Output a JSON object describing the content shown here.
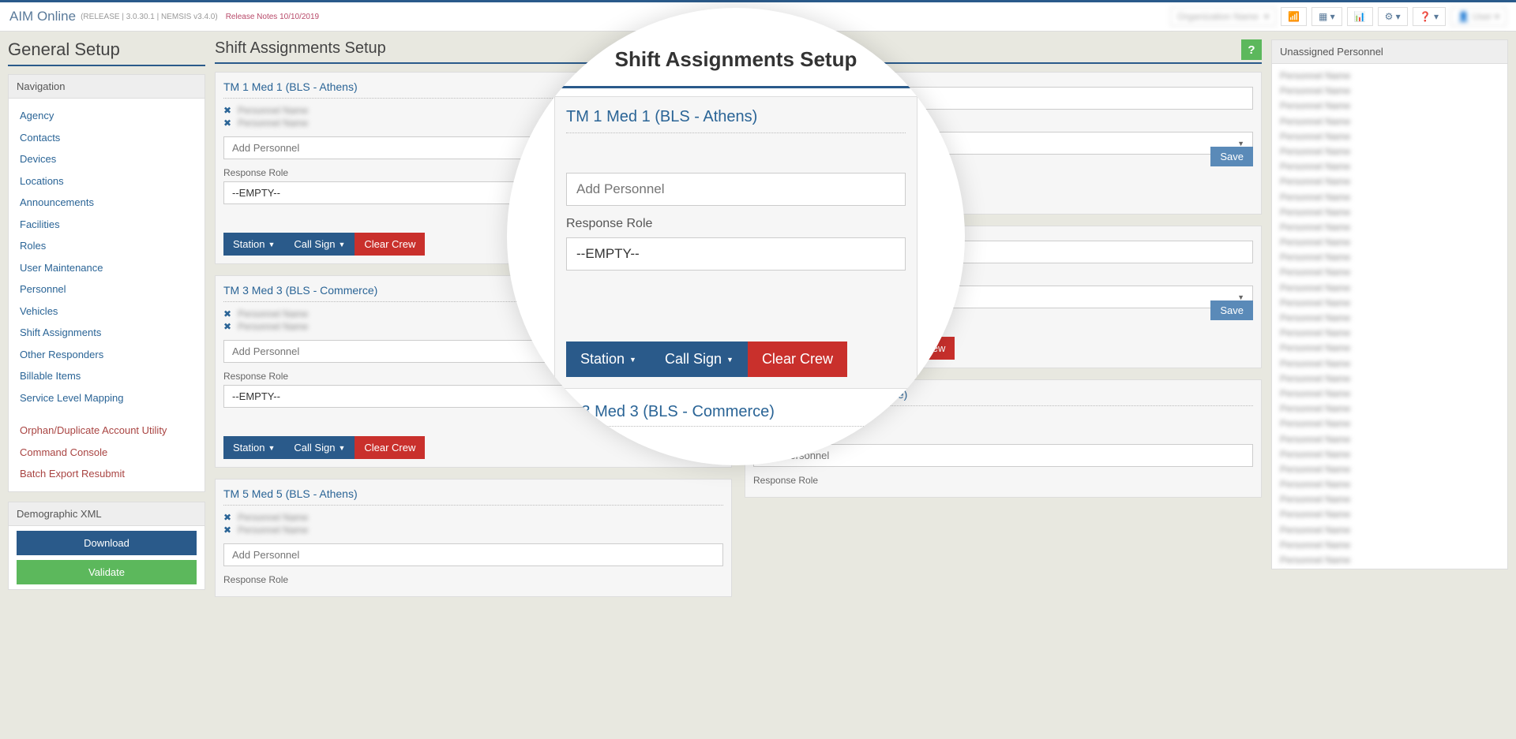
{
  "header": {
    "brand": "AIM Online",
    "meta": "(RELEASE | 3.0.30.1 | NEMSIS v3.4.0)",
    "release_notes": "Release Notes 10/10/2019",
    "help_label": "?"
  },
  "page": {
    "title": "General Setup",
    "section_title": "Shift Assignments Setup"
  },
  "nav": {
    "header": "Navigation",
    "items": [
      "Agency",
      "Contacts",
      "Devices",
      "Locations",
      "Announcements",
      "Facilities",
      "Roles",
      "User Maintenance",
      "Personnel",
      "Vehicles",
      "Shift Assignments",
      "Other Responders",
      "Billable Items",
      "Service Level Mapping"
    ],
    "admin_items": [
      "Orphan/Duplicate Account Utility",
      "Command Console",
      "Batch Export Resubmit"
    ]
  },
  "demo_xml": {
    "header": "Demographic XML",
    "download": "Download",
    "validate": "Validate"
  },
  "labels": {
    "add_personnel": "Add Personnel",
    "response_role": "Response Role",
    "empty_option": "--EMPTY--",
    "station": "Station",
    "call_sign": "Call Sign",
    "clear_crew": "Clear Crew",
    "save": "Save"
  },
  "shifts": {
    "left": [
      {
        "title": "TM 1 Med 1 (BLS - Athens)",
        "crew": [
          "—",
          "—"
        ]
      },
      {
        "title": "TM 3 Med 3 (BLS - Commerce)",
        "crew": [
          "—",
          "—"
        ]
      },
      {
        "title": "TM 5 Med 5 (BLS - Athens)",
        "crew": [
          "—",
          "—"
        ]
      }
    ],
    "right": [
      {
        "title": "",
        "crew": []
      },
      {
        "title": "",
        "crew": []
      },
      {
        "title": "TM 6 Med 6 (BLS - Commerce)",
        "crew": [
          "—",
          "—"
        ]
      }
    ]
  },
  "unassigned": {
    "header": "Unassigned Personnel",
    "count": 38
  },
  "zoom": {
    "section_title": "Shift Assignments Setup",
    "shift_title": "TM 1 Med 1 (BLS - Athens)",
    "add_personnel": "Add Personnel",
    "response_role": "Response Role",
    "empty_option": "--EMPTY--",
    "station": "Station",
    "call_sign": "Call Sign",
    "clear_crew": "Clear Crew",
    "next_title": "TM 3 Med 3 (BLS - Commerce)"
  }
}
